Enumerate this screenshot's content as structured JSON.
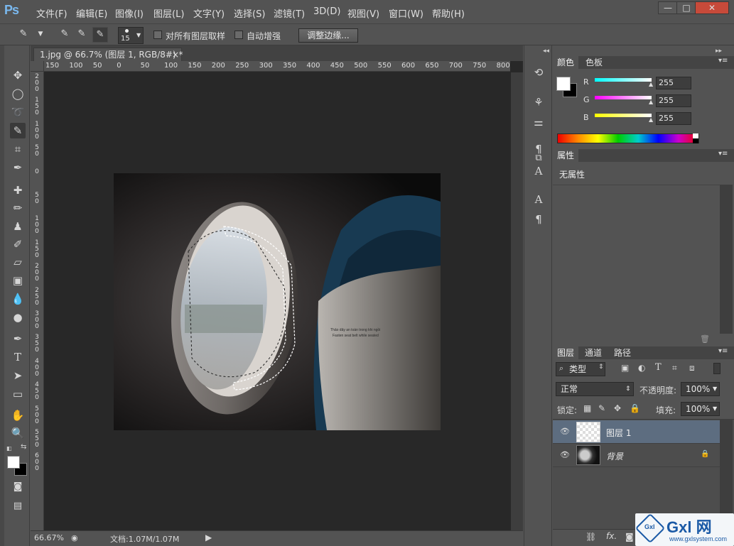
{
  "app": {
    "logo": "Ps"
  },
  "menu": [
    "文件(F)",
    "编辑(E)",
    "图像(I)",
    "图层(L)",
    "文字(Y)",
    "选择(S)",
    "滤镜(T)",
    "3D(D)",
    "视图(V)",
    "窗口(W)",
    "帮助(H)"
  ],
  "window_controls": {
    "minimize": "—",
    "maximize": "□",
    "close": "✕"
  },
  "options": {
    "brush_size": "15",
    "sample_all_layers": "对所有图层取样",
    "auto_enhance": "自动增强",
    "refine_edge": "调整边缘..."
  },
  "document": {
    "tab_title": "1.jpg @ 66.7% (图层 1, RGB/8#) *",
    "tab_close": "×",
    "ruler_h": [
      "150",
      "100",
      "50",
      "0",
      "50",
      "100",
      "150",
      "200",
      "250",
      "300",
      "350",
      "400",
      "450",
      "500",
      "550",
      "600",
      "650",
      "700",
      "750",
      "800"
    ],
    "ruler_v": [
      "2\n0\n0",
      "1\n5\n0",
      "1\n0\n0",
      "5\n0",
      "0",
      "5\n0",
      "1\n0\n0",
      "1\n5\n0",
      "2\n0\n0",
      "2\n5\n0",
      "3\n0\n0",
      "3\n5\n0",
      "4\n0\n0",
      "4\n5\n0",
      "5\n0\n0",
      "5\n5\n0",
      "6\n0\n0"
    ],
    "photo_caption_line1": "Thảo dây an toàn trong khi ngồi",
    "photo_caption_line2": "Fasten seat belt while seated"
  },
  "status": {
    "zoom": "66.67%",
    "doc_info": "文档:1.07M/1.07M"
  },
  "color_panel": {
    "tabs": [
      "颜色",
      "色板"
    ],
    "channels": [
      {
        "label": "R",
        "value": "255",
        "color": "#00ffff"
      },
      {
        "label": "G",
        "value": "255",
        "color": "#ff00ff"
      },
      {
        "label": "B",
        "value": "255",
        "color": "#ffff00"
      }
    ]
  },
  "properties_panel": {
    "tab": "属性",
    "text": "无属性"
  },
  "layers_panel": {
    "tabs": [
      "图层",
      "通道",
      "路径"
    ],
    "filter_kind": "类型",
    "blend_mode": "正常",
    "opacity_label": "不透明度:",
    "opacity": "100%",
    "lock_label": "锁定:",
    "fill_label": "填充:",
    "fill": "100%",
    "layers": [
      {
        "name": "图层 1",
        "selected": true
      },
      {
        "name": "背景",
        "selected": false
      }
    ]
  },
  "watermark": {
    "text": "Gxl 网",
    "url": "www.gxlsystem.com"
  },
  "colors": {
    "accent": "#7ab8ee",
    "selected_layer": "#5d6d80"
  }
}
